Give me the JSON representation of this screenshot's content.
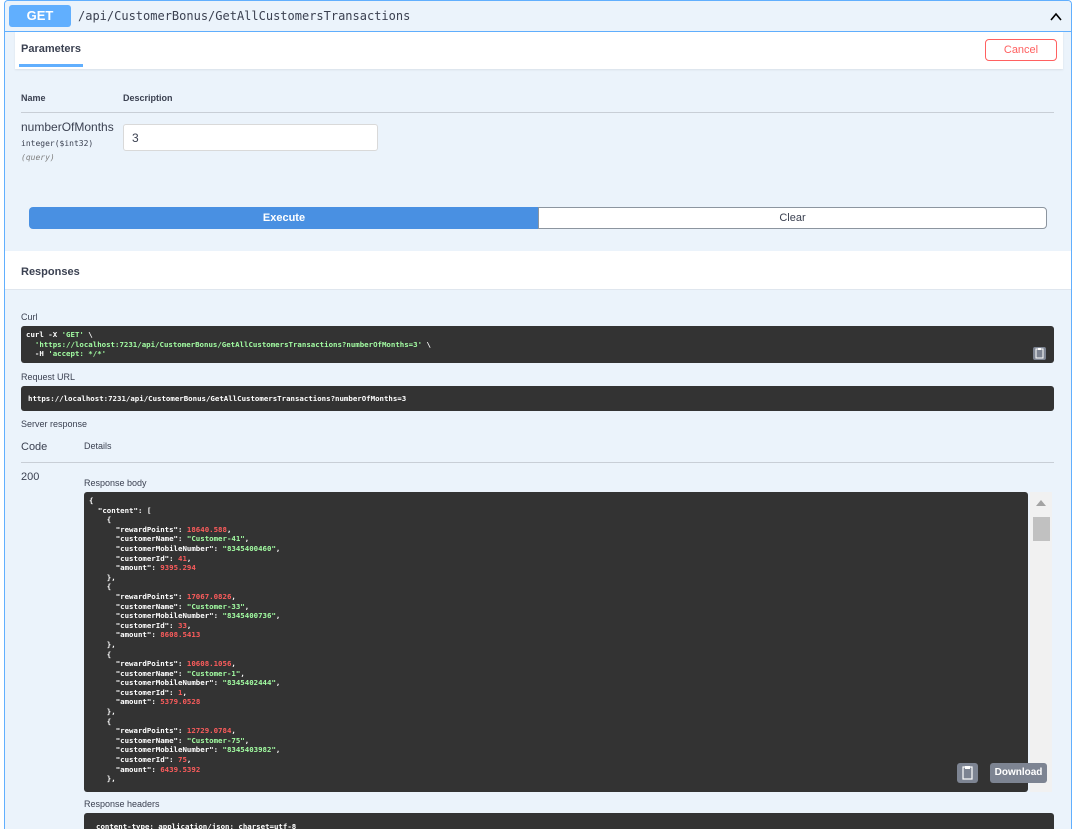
{
  "summary": {
    "method": "GET",
    "path": "/api/CustomerBonus/GetAllCustomersTransactions"
  },
  "params_section": {
    "tab_label": "Parameters",
    "cancel_label": "Cancel",
    "col_name": "Name",
    "col_description": "Description",
    "param": {
      "name": "numberOfMonths",
      "type": "integer($int32)",
      "in": "(query)",
      "value": "3"
    },
    "execute_label": "Execute",
    "clear_label": "Clear"
  },
  "responses": {
    "title": "Responses",
    "curl_label": "Curl",
    "curl_line1": "curl -X ",
    "curl_method": "'GET'",
    "curl_line1_end": " \\",
    "curl_url": "'https://localhost:7231/api/CustomerBonus/GetAllCustomersTransactions?numberOfMonths=3'",
    "curl_line2_end": " \\",
    "curl_line3_prefix": "  -H ",
    "curl_header": "'accept: */*'",
    "request_url_label": "Request URL",
    "request_url": "https://localhost:7231/api/CustomerBonus/GetAllCustomersTransactions?numberOfMonths=3",
    "server_response_label": "Server response",
    "code_label": "Code",
    "details_label": "Details",
    "status_code": "200",
    "response_body_label": "Response body",
    "body_open": "{",
    "body_content_key": "\"content\"",
    "body_content_open": ": [",
    "items": [
      {
        "rewardPoints": "18640.588",
        "customerName": "\"Customer-41\"",
        "customerMobileNumber": "\"8345400460\"",
        "customerId": "41",
        "amount": "9395.294"
      },
      {
        "rewardPoints": "17067.0826",
        "customerName": "\"Customer-33\"",
        "customerMobileNumber": "\"8345400736\"",
        "customerId": "33",
        "amount": "8608.5413"
      },
      {
        "rewardPoints": "10608.1056",
        "customerName": "\"Customer-1\"",
        "customerMobileNumber": "\"8345402444\"",
        "customerId": "1",
        "amount": "5379.0528"
      },
      {
        "rewardPoints": "12729.0784",
        "customerName": "\"Customer-75\"",
        "customerMobileNumber": "\"8345403982\"",
        "customerId": "75",
        "amount": "6439.5392"
      }
    ],
    "key_rewardPoints": "\"rewardPoints\"",
    "key_customerName": "\"customerName\"",
    "key_customerMobileNumber": "\"customerMobileNumber\"",
    "key_customerId": "\"customerId\"",
    "key_amount": "\"amount\"",
    "download_label": "Download",
    "response_headers_label": "Response headers",
    "response_headers_value": "content-type: application/json; charset=utf-8"
  },
  "icons": {
    "collapse": "chevron-up-icon",
    "copy": "copy-icon"
  },
  "colors": {
    "get_accent": "#61affe",
    "execute": "#4990e2",
    "cancel": "#ff6060",
    "code_bg": "#333333",
    "number": "#fc5c5c",
    "string": "#a2fca2"
  }
}
